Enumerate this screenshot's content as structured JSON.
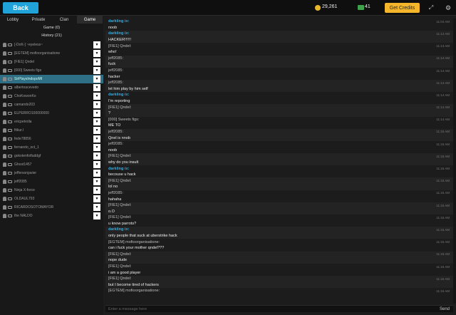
{
  "topbar": {
    "back_label": "Back",
    "coins": "29,261",
    "points": "41",
    "get_credits_label": "Get Credits"
  },
  "tabs": [
    "Lobby",
    "Private",
    "Clan",
    "Game"
  ],
  "sections": {
    "game": "Game (0)",
    "history": "History (21)"
  },
  "players": [
    "[-DoK-] ~eyeless~",
    "[EGTEM] mofioorganisatione",
    "[FIE1] Qndel",
    "[000] Sweets figs",
    "SirPlaysIndopoMI",
    "albertoacevedo",
    "ChoKowonKo",
    "camando203",
    "ELPERRO100000000",
    "ericpetrolla",
    "fitkur.l",
    "fede78856",
    "fernando_oct_1",
    "gokotenfotfuddgf",
    "Ghost1457",
    "jeffersonjavier",
    "jeff2085",
    "Ninja X-force",
    "OLDAUL793",
    "RICARDOSOTOMAYOR",
    "the NALDO"
  ],
  "messages": [
    {
      "sender": "darkling ix:",
      "text": "noob",
      "time": "11:04 AM",
      "blue": true
    },
    {
      "sender": "darkling ix:",
      "text": "HACKER!!!!!!",
      "time": "11:13 AM",
      "blue": true
    },
    {
      "sender": "[FIE1] Qndel:",
      "text": "who!",
      "time": "11:13 AM",
      "blue": false
    },
    {
      "sender": "jeff2085:",
      "text": "fuck",
      "time": "11:14 AM",
      "blue": false
    },
    {
      "sender": "jeff2085:",
      "text": "hacker",
      "time": "11:14 AM",
      "blue": false
    },
    {
      "sender": "jeff2085:",
      "text": "let him play by him self",
      "time": "11:14 AM",
      "blue": false
    },
    {
      "sender": "darkling ix:",
      "text": "I'm reporting",
      "time": "11:14 AM",
      "blue": true
    },
    {
      "sender": "[FIE1] Qndel:",
      "text": "?",
      "time": "11:14 AM",
      "blue": false
    },
    {
      "sender": "[000] Sweets figs:",
      "text": "ME TO",
      "time": "11:14 AM",
      "blue": false
    },
    {
      "sender": "jeff2085:",
      "text": "Qnel is nnob",
      "time": "11:15 AM",
      "blue": false
    },
    {
      "sender": "jeff2085:",
      "text": "noob",
      "time": "11:15 AM",
      "blue": false
    },
    {
      "sender": "[FIE1] Qndel:",
      "text": "why do you insult",
      "time": "11:15 AM",
      "blue": false
    },
    {
      "sender": "darkling ix:",
      "text": "becouse u hack",
      "time": "11:15 AM",
      "blue": true
    },
    {
      "sender": "[FIE1] Qndel:",
      "text": "lol no",
      "time": "11:15 AM",
      "blue": false
    },
    {
      "sender": "jeff2085:",
      "text": "hahaha",
      "time": "11:15 AM",
      "blue": false
    },
    {
      "sender": "[FIE1] Qndel:",
      "text": "o.O",
      "time": "11:15 AM",
      "blue": false
    },
    {
      "sender": "[FIE1] Qndel:",
      "text": "u know parrots?",
      "time": "11:15 AM",
      "blue": false
    },
    {
      "sender": "darkling ix:",
      "text": "only people that suck at uberstrike hack",
      "time": "11:15 AM",
      "blue": true
    },
    {
      "sender": "[EGTEM] mofioorganisatione:",
      "text": "can i fuck your mother qndel???",
      "time": "11:15 AM",
      "blue": false
    },
    {
      "sender": "[FIE1] Qndel:",
      "text": "nope dude",
      "time": "11:15 AM",
      "blue": false
    },
    {
      "sender": "[FIE1] Qndel:",
      "text": "i am a good player",
      "time": "11:16 AM",
      "blue": false
    },
    {
      "sender": "[FIE1] Qndel:",
      "text": "but I become tired of hackers",
      "time": "11:16 AM",
      "blue": false
    },
    {
      "sender": "[EGTEM] mofioorganisatione:",
      "text": "",
      "time": "11:16 AM",
      "blue": false
    }
  ],
  "input": {
    "placeholder": "Enter a message here",
    "send_label": "Send"
  },
  "icons": {
    "coin": "coin-icon",
    "credit": "credit-icon",
    "expand": "expand-icon",
    "settings": "gear-icon"
  },
  "colors": {
    "accent": "#1fa3d8",
    "gold": "#f5b62b",
    "selected_row": "#2f6f86"
  }
}
